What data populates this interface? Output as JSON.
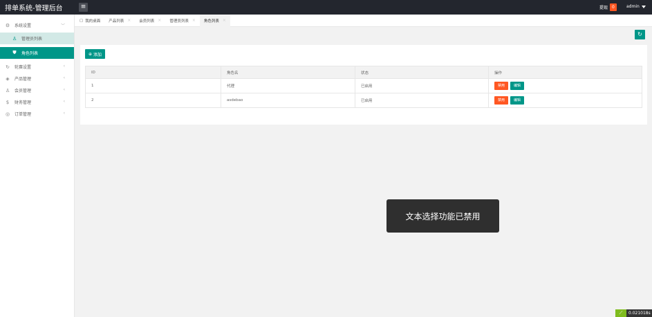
{
  "header": {
    "title": "排单系统-管理后台",
    "menu_toggle_icon": "≡",
    "notice_label": "提现",
    "notice_count": "0",
    "user": "admin"
  },
  "sidebar": {
    "items": [
      {
        "label": "系统设置",
        "icon": "gear-icon",
        "arrow": "﹀"
      },
      {
        "label": "管理员列表",
        "icon": "user-icon"
      },
      {
        "label": "角色列表",
        "icon": "shield-icon"
      },
      {
        "label": "轮赛设置",
        "icon": "refresh-icon",
        "arrow": "‹"
      },
      {
        "label": "产品管理",
        "icon": "tag-icon",
        "arrow": "‹"
      },
      {
        "label": "会员管理",
        "icon": "user-icon",
        "arrow": "‹"
      },
      {
        "label": "财务管理",
        "icon": "money-icon",
        "arrow": "‹"
      },
      {
        "label": "订单管理",
        "icon": "order-icon",
        "arrow": "‹"
      }
    ]
  },
  "tabs": [
    {
      "label": "我的桌面"
    },
    {
      "label": "产品列表"
    },
    {
      "label": "会员列表"
    },
    {
      "label": "管理员列表"
    },
    {
      "label": "角色列表"
    }
  ],
  "toolbar": {
    "add_label": "添加",
    "refresh_icon": "↻"
  },
  "table": {
    "headers": [
      "ID",
      "角色名",
      "状态",
      "操作"
    ],
    "rows": [
      {
        "id": "1",
        "name": "代理",
        "status": "已启用",
        "disable": "禁用",
        "edit": "编辑"
      },
      {
        "id": "2",
        "name": "asdebao",
        "status": "已启用",
        "disable": "禁用",
        "edit": "编辑"
      }
    ]
  },
  "toast": "文本选择功能已禁用",
  "timer": "0.021018s",
  "colors": {
    "accent": "#009688",
    "danger": "#ff5722",
    "topbar": "#23262e"
  }
}
